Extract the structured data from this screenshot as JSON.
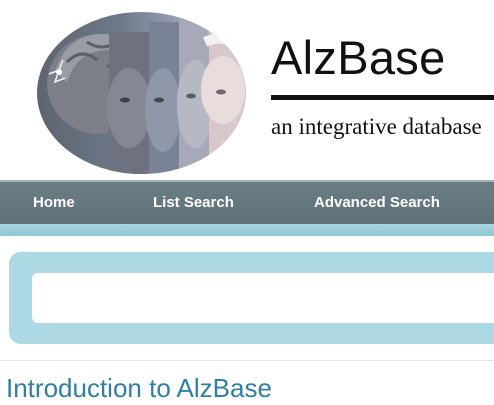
{
  "header": {
    "title": "AlzBase",
    "tagline": "an integrative database"
  },
  "nav": {
    "items": [
      {
        "label": "Home"
      },
      {
        "label": "List Search"
      },
      {
        "label": "Advanced Search"
      }
    ]
  },
  "search": {
    "value": "",
    "placeholder": ""
  },
  "main": {
    "section_title": "Introduction to AlzBase"
  },
  "colors": {
    "nav_bar": "#627680",
    "nav_strip": "#a8d4df",
    "search_frame": "#add9e4",
    "heading": "#2f7fa6"
  }
}
